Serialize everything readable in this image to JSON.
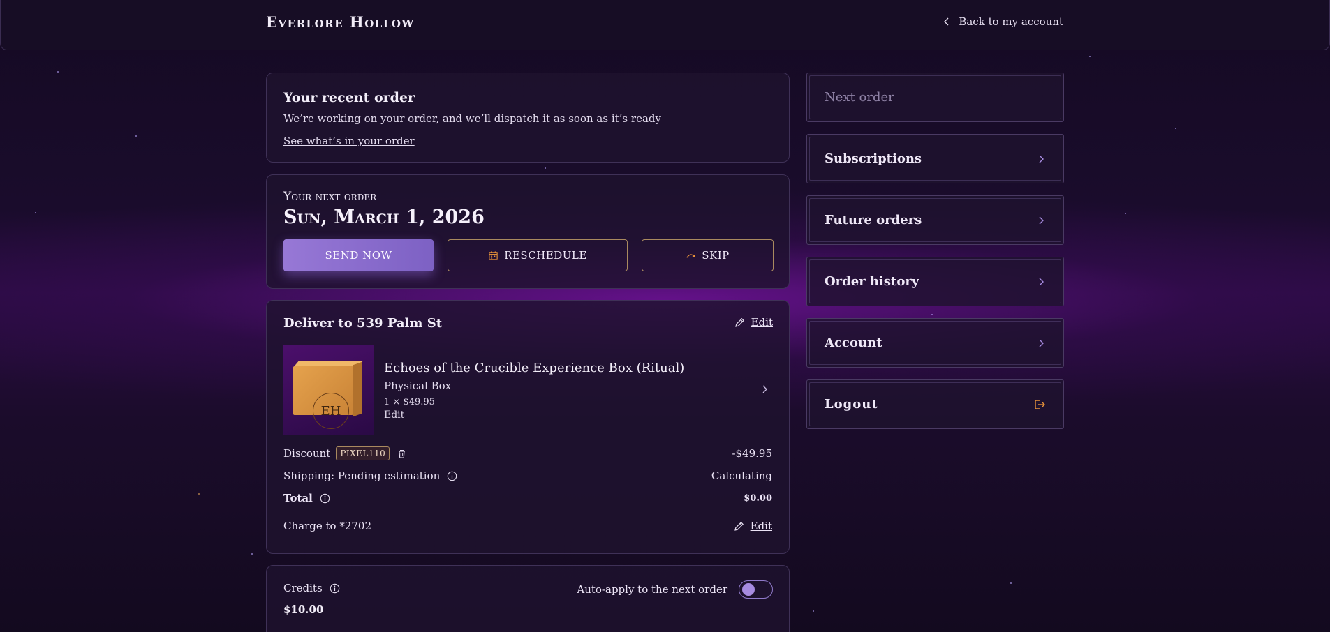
{
  "header": {
    "brand": "Everlore Hollow",
    "back_label": "Back to my account"
  },
  "recent_order": {
    "title": "Your recent order",
    "message": "We’re working on your order, and we’ll dispatch it as soon as it’s ready",
    "link": "See what’s in your order"
  },
  "next_order": {
    "heading": "Your next order",
    "date": "Sun, March 1, 2026",
    "send_now": "SEND NOW",
    "reschedule": "RESCHEDULE",
    "skip": "SKIP"
  },
  "delivery": {
    "title": "Deliver to 539 Palm St",
    "edit": "Edit",
    "product": {
      "name": "Echoes of the Crucible Experience Box (Ritual)",
      "type": "Physical Box",
      "qty_price": "1 × $49.95",
      "edit": "Edit",
      "box_monogram": "EH"
    },
    "discount_label": "Discount",
    "discount_code": "PIXEL110",
    "discount_value": "-$49.95",
    "shipping_label": "Shipping: Pending estimation",
    "shipping_value": "Calculating",
    "total_label": "Total",
    "total_value": "$0.00",
    "charge_label": "Charge to *2702",
    "charge_edit": "Edit"
  },
  "credits": {
    "label": "Credits",
    "amount": "$10.00",
    "auto_apply_label": "Auto-apply to the next order",
    "auto_apply_on": true
  },
  "sidebar": {
    "items": [
      {
        "label": "Next order",
        "icon": "none",
        "disabled": true
      },
      {
        "label": "Subscriptions",
        "icon": "chevron-right-icon"
      },
      {
        "label": "Future orders",
        "icon": "chevron-right-icon"
      },
      {
        "label": "Order history",
        "icon": "chevron-right-icon"
      },
      {
        "label": "Account",
        "icon": "chevron-right-icon"
      },
      {
        "label": "Logout",
        "icon": "logout-icon"
      }
    ]
  },
  "colors": {
    "accent_purple": "#9778d6",
    "gold_outline": "#a98a5f",
    "chevron_purple": "#a78be0",
    "logout_orange": "#e8923a"
  }
}
